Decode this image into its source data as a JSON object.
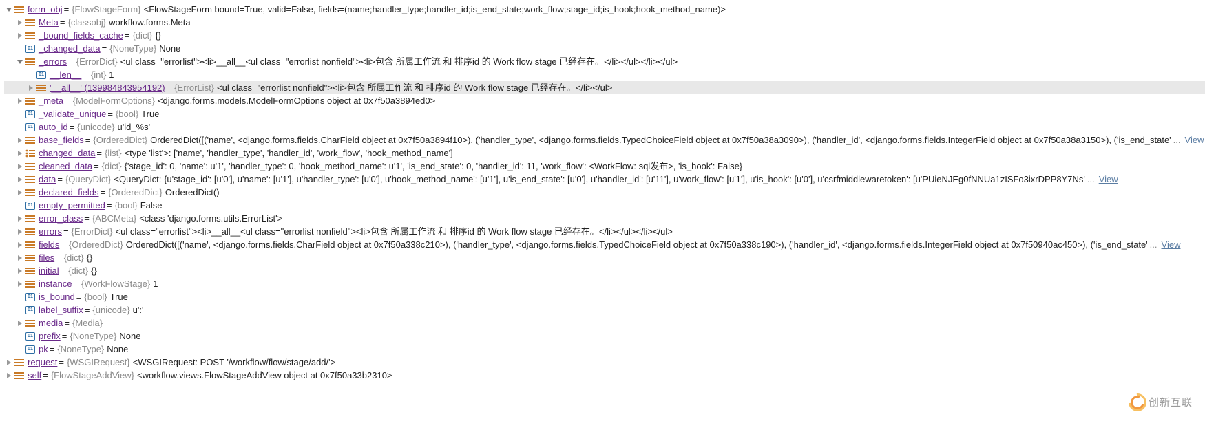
{
  "root": {
    "name": "form_obj",
    "type": "{FlowStageForm}",
    "value": "<FlowStageForm bound=True, valid=False, fields=(name;handler_type;handler_id;is_end_state;work_flow;stage_id;is_hook;hook_method_name)>"
  },
  "level1": {
    "meta": {
      "name": "Meta",
      "type": "{classobj}",
      "value": "workflow.forms.Meta"
    },
    "bfc": {
      "name": "_bound_fields_cache",
      "type": "{dict}",
      "value": "{}"
    },
    "changed": {
      "name": "_changed_data",
      "type": "{NoneType}",
      "value": "None"
    },
    "errors": {
      "name": "_errors",
      "type": "{ErrorDict}",
      "value": "<ul class=\"errorlist\"><li>__all__<ul class=\"errorlist nonfield\"><li>包含 所属工作流 和 排序id 的 Work flow stage 已经存在。</li></ul></li></ul>"
    },
    "metaOpt": {
      "name": "_meta",
      "type": "{ModelFormOptions}",
      "value": "<django.forms.models.ModelFormOptions object at 0x7f50a3894ed0>"
    },
    "validate": {
      "name": "_validate_unique",
      "type": "{bool}",
      "value": "True"
    },
    "autoid": {
      "name": "auto_id",
      "type": "{unicode}",
      "value": "u'id_%s'"
    },
    "basefields": {
      "name": "base_fields",
      "type": "{OrderedDict}",
      "value": "OrderedDict([('name', <django.forms.fields.CharField object at 0x7f50a3894f10>), ('handler_type', <django.forms.fields.TypedChoiceField object at 0x7f50a38a3090>), ('handler_id', <django.forms.fields.IntegerField object at 0x7f50a38a3150>), ('is_end_state'"
    },
    "changed2": {
      "name": "changed_data",
      "type": "{list}",
      "value": "<type 'list'>: ['name', 'handler_type', 'handler_id', 'work_flow', 'hook_method_name']"
    },
    "cleaned": {
      "name": "cleaned_data",
      "type": "{dict}",
      "value": "{'stage_id': 0, 'name': u'1', 'handler_type': 0, 'hook_method_name': u'1', 'is_end_state': 0, 'handler_id': 11, 'work_flow': <WorkFlow: sql发布>, 'is_hook': False}"
    },
    "data": {
      "name": "data",
      "type": "{QueryDict}",
      "value": "<QueryDict: {u'stage_id': [u'0'], u'name': [u'1'], u'handler_type': [u'0'], u'hook_method_name': [u'1'], u'is_end_state': [u'0'], u'handler_id': [u'11'], u'work_flow': [u'1'], u'is_hook': [u'0'], u'csrfmiddlewaretoken': [u'PUieNJEg0fNNUa1zISFo3ixrDPP8Y7Ns'"
    },
    "declared": {
      "name": "declared_fields",
      "type": "{OrderedDict}",
      "value": "OrderedDict()"
    },
    "empty": {
      "name": "empty_permitted",
      "type": "{bool}",
      "value": "False"
    },
    "errclass": {
      "name": "error_class",
      "type": "{ABCMeta}",
      "value": "<class 'django.forms.utils.ErrorList'>"
    },
    "errors2": {
      "name": "errors",
      "type": "{ErrorDict}",
      "value": "<ul class=\"errorlist\"><li>__all__<ul class=\"errorlist nonfield\"><li>包含 所属工作流 和 排序id 的 Work flow stage 已经存在。</li></ul></li></ul>"
    },
    "fields": {
      "name": "fields",
      "type": "{OrderedDict}",
      "value": "OrderedDict([('name', <django.forms.fields.CharField object at 0x7f50a338c210>), ('handler_type', <django.forms.fields.TypedChoiceField object at 0x7f50a338c190>), ('handler_id', <django.forms.fields.IntegerField object at 0x7f50940ac450>), ('is_end_state'"
    },
    "files": {
      "name": "files",
      "type": "{dict}",
      "value": "{}"
    },
    "initial": {
      "name": "initial",
      "type": "{dict}",
      "value": "{}"
    },
    "instance": {
      "name": "instance",
      "type": "{WorkFlowStage}",
      "value": "1"
    },
    "isbound": {
      "name": "is_bound",
      "type": "{bool}",
      "value": "True"
    },
    "labelsfx": {
      "name": "label_suffix",
      "type": "{unicode}",
      "value": "u':'"
    },
    "media": {
      "name": "media",
      "type": "{Media}",
      "value": ""
    },
    "prefix": {
      "name": "prefix",
      "type": "{NoneType}",
      "value": "None"
    }
  },
  "errorsChildren": {
    "len": {
      "name": "__len__",
      "type": "{int}",
      "value": "1"
    },
    "all": {
      "name": "'__all__' (139984843954192)",
      "type": "{ErrorList}",
      "value": "<ul class=\"errorlist nonfield\"><li>包含 所属工作流 和 排序id 的 Work flow stage 已经存在。</li></ul>"
    }
  },
  "siblings": {
    "pk": {
      "name": "pk",
      "type": "{NoneType}",
      "value": "None"
    },
    "request": {
      "name": "request",
      "type": "{WSGIRequest}",
      "value": "<WSGIRequest: POST '/workflow/flow/stage/add/'>"
    },
    "self": {
      "name": "self",
      "type": "{FlowStageAddView}",
      "value": "<workflow.views.FlowStageAddView object at 0x7f50a33b2310>"
    }
  },
  "strings": {
    "ellipsis": "...",
    "view": "View"
  },
  "watermark": "创新互联"
}
